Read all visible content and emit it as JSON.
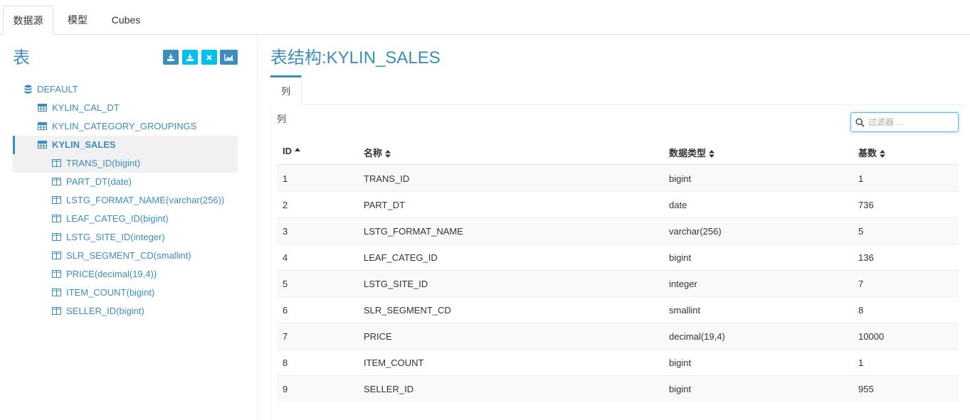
{
  "top_tabs": [
    {
      "label": "数据源",
      "active": true
    },
    {
      "label": "模型",
      "active": false
    },
    {
      "label": "Cubes",
      "active": false
    }
  ],
  "left": {
    "title": "表",
    "toolbar": [
      {
        "icon": "load-table-icon"
      },
      {
        "icon": "load-from-tree-icon"
      },
      {
        "icon": "unload-table-icon"
      },
      {
        "icon": "chart-icon"
      }
    ],
    "database": "DEFAULT",
    "tables": [
      "KYLIN_CAL_DT",
      "KYLIN_CATEGORY_GROUPINGS",
      "KYLIN_SALES"
    ],
    "columns": [
      "TRANS_ID(bigint)",
      "PART_DT(date)",
      "LSTG_FORMAT_NAME(varchar(256))",
      "LEAF_CATEG_ID(bigint)",
      "LSTG_SITE_ID(integer)",
      "SLR_SEGMENT_CD(smallint)",
      "PRICE(decimal(19,4))",
      "ITEM_COUNT(bigint)",
      "SELLER_ID(bigint)"
    ]
  },
  "right": {
    "title": "表结构:KYLIN_SALES",
    "sub_tab": "列",
    "section_label": "列",
    "filter_placeholder": "过滤器 ...",
    "headers": [
      "ID",
      "名称",
      "数据类型",
      "基数"
    ],
    "rows": [
      [
        "1",
        "TRANS_ID",
        "bigint",
        "1"
      ],
      [
        "2",
        "PART_DT",
        "date",
        "736"
      ],
      [
        "3",
        "LSTG_FORMAT_NAME",
        "varchar(256)",
        "5"
      ],
      [
        "4",
        "LEAF_CATEG_ID",
        "bigint",
        "136"
      ],
      [
        "5",
        "LSTG_SITE_ID",
        "integer",
        "7"
      ],
      [
        "6",
        "SLR_SEGMENT_CD",
        "smallint",
        "8"
      ],
      [
        "7",
        "PRICE",
        "decimal(19,4)",
        "10000"
      ],
      [
        "8",
        "ITEM_COUNT",
        "bigint",
        "1"
      ],
      [
        "9",
        "SELLER_ID",
        "bigint",
        "955"
      ]
    ]
  },
  "colors": {
    "accent": "#3c8dbc",
    "button_blue": "#3c8dbc",
    "button_cyan": "#00c0ef"
  }
}
